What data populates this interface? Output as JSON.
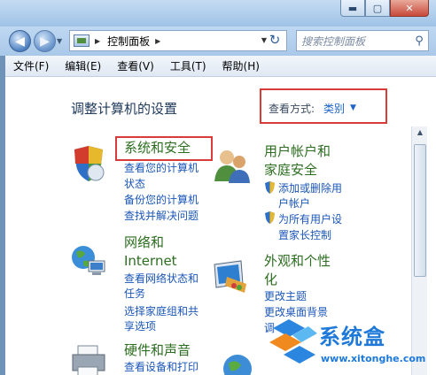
{
  "window": {
    "min_symbol": "▬",
    "max_symbol": "▢",
    "close_symbol": "✕"
  },
  "nav": {
    "back_symbol": "◀",
    "forward_symbol": "▶",
    "dropdown_symbol": "▼",
    "address_separator": "▶",
    "address_text": "控制面板",
    "refresh_symbol": "↻",
    "search_placeholder": "搜索控制面板",
    "search_symbol": "⚲"
  },
  "menu": {
    "items": [
      "文件(F)",
      "编辑(E)",
      "查看(V)",
      "工具(T)",
      "帮助(H)"
    ]
  },
  "main": {
    "title": "调整计算机的设置",
    "viewby_label": "查看方式:",
    "viewby_value": "类别",
    "viewby_arrow": "▼"
  },
  "categories": {
    "system": {
      "title": "系统和安全",
      "links": [
        "查看您的计算机",
        "状态",
        "备份您的计算机",
        "查找并解决问题"
      ]
    },
    "users": {
      "title_line1": "用户帐户和",
      "title_line2": "家庭安全",
      "links": [
        "添加或删除用",
        "户帐户",
        "为所有用户设",
        "置家长控制"
      ]
    },
    "network": {
      "title_line1": "网络和",
      "title_line2": "Internet",
      "links": [
        "查看网络状态和",
        "任务",
        "选择家庭组和共",
        "享选项"
      ]
    },
    "appearance": {
      "title_line1": "外观和个性",
      "title_line2": "化",
      "links": [
        "更改主题",
        "更改桌面背景",
        "调"
      ]
    },
    "hardware": {
      "title": "硬件和声音",
      "links": [
        "查看设备和打印"
      ]
    }
  },
  "watermark": {
    "name": "系统盒",
    "url": "www.xitonghe.com"
  },
  "scroll": {
    "up_symbol": "▲"
  }
}
